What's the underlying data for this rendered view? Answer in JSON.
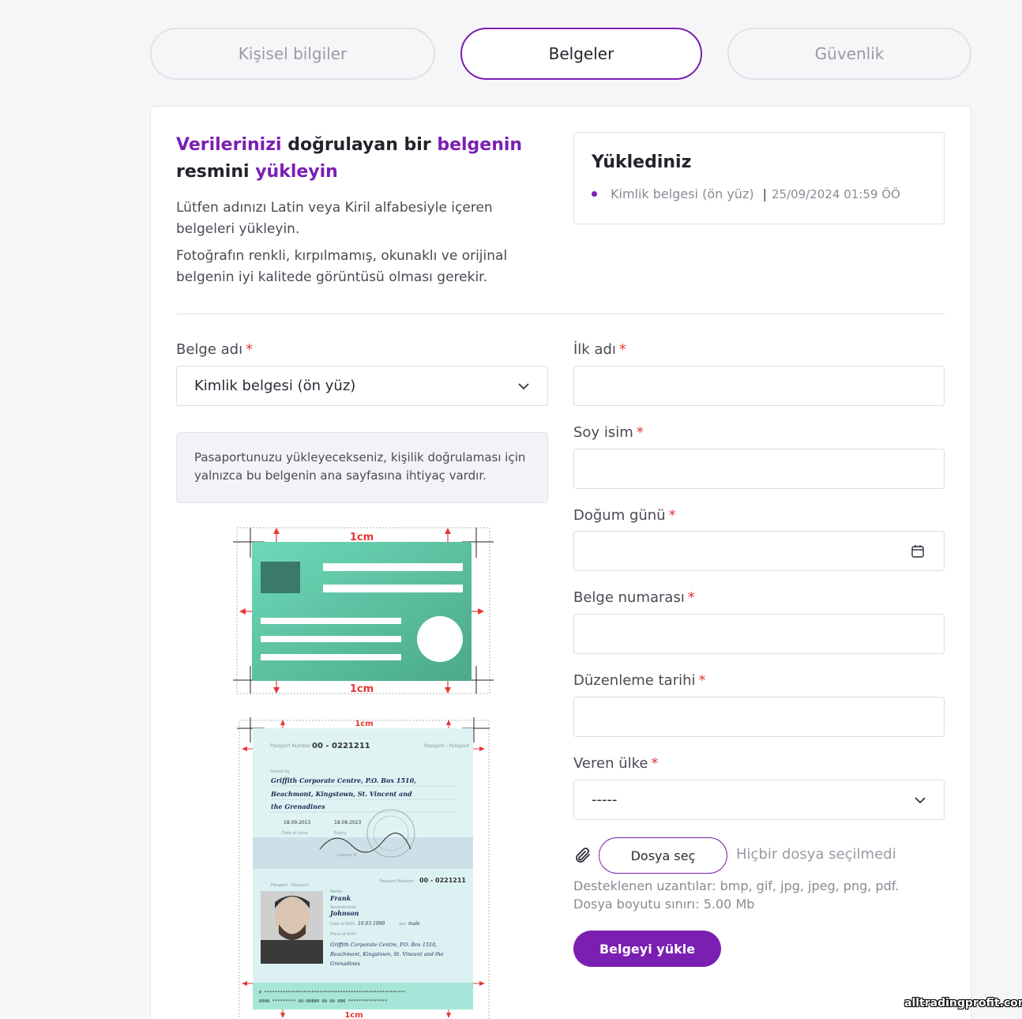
{
  "tabs": [
    {
      "label": "Kişisel bilgiler",
      "active": false
    },
    {
      "label": "Belgeler",
      "active": true
    },
    {
      "label": "Güvenlik",
      "active": false
    }
  ],
  "heading": {
    "w1": "Verilerinizi",
    "w2": " doğrulayan bir ",
    "w3": "belgenin",
    "w4": "resmini ",
    "w5": "yükleyin"
  },
  "intro": {
    "p1": "Lütfen adınızı Latin veya Kiril alfabesiyle içeren belgeleri yükleyin.",
    "p2": "Fotoğrafın renkli, kırpılmamış, okunaklı ve orijinal belgenin iyi kalitede görüntüsü olması gerekir."
  },
  "uploaded": {
    "title": "Yüklediniz",
    "items": [
      {
        "name": "Kimlik belgesi (ön yüz)",
        "separator": "|",
        "date": "25/09/2024 01:59 ÖÖ"
      }
    ]
  },
  "form": {
    "doc_name": {
      "label": "Belge adı",
      "value": "Kimlik belgesi (ön yüz)"
    },
    "first_name": {
      "label": "İlk adı",
      "value": ""
    },
    "last_name": {
      "label": "Soy isim",
      "value": ""
    },
    "birthday": {
      "label": "Doğum günü",
      "value": ""
    },
    "doc_number": {
      "label": "Belge numarası",
      "value": ""
    },
    "issue_date": {
      "label": "Düzenleme tarihi",
      "value": ""
    },
    "issuing_country": {
      "label": "Veren ülke",
      "value": "-----"
    },
    "required_mark": "*"
  },
  "notice": "Pasaportunuzu yükleyecekseniz, kişilik doğrulaması için yalnızca bu belgenin ana sayfasına ihtiyaç vardır.",
  "id_card_illustration": {
    "margin_label_top": "1cm",
    "margin_label_bottom": "1cm"
  },
  "passport_illustration": {
    "margin_label_top": "1cm",
    "margin_label_bottom": "1cm",
    "passport_number_label": "Passport Number",
    "passport_number": "00 - 0221211",
    "passport_type": "Passport - Passport",
    "issued_by_label": "Issued by",
    "issued_by_line1": "Griffith Corporate Centre, P.O. Box 1510,",
    "issued_by_line2": "Beachmont, Kingstown, St. Vincent and",
    "issued_by_line3": "the Grenadines",
    "date_issue": "18.09.2013",
    "date_issue_label": "Date of issue",
    "date_expiry": "18.08.2023",
    "date_expiry_label": "Expiry",
    "license_label": "License N",
    "page2_type": "Passport - Passport",
    "page2_number_label": "Passport Number",
    "page2_number": "00 - 0221211",
    "name_label": "Name",
    "name": "Frank",
    "surname_label": "Secondname",
    "surname": "Johnson",
    "dob_label": "Date of Birth",
    "dob": "16.03.1990",
    "sex_label": "Sex",
    "sex": "male",
    "pob_label": "Place of birth",
    "pob_line1": "Griffith Corporate Centre, P.O. Box 1510,",
    "pob_line2": "Beachmont, Kingstown, St. Vincent and the",
    "pob_line3": "Grenadines",
    "mrz1": "P ******************************************************",
    "mrz2": "0000 ********* UU-00880 00 00 000 ***************"
  },
  "file": {
    "choose_label": "Dosya seç",
    "no_file": "Hiçbir dosya seçilmedi",
    "hint": "Desteklenen uzantılar: bmp, gif, jpg, jpeg, png, pdf. Dosya boyutu sınırı: 5.00 Mb"
  },
  "submit_label": "Belgeyi yükle",
  "watermark": "alltradingprofit.com",
  "colors": {
    "accent": "#7b1fb3",
    "required": "#e53935",
    "card_green": "#5cc6a6",
    "arrow_red": "#e53935"
  }
}
